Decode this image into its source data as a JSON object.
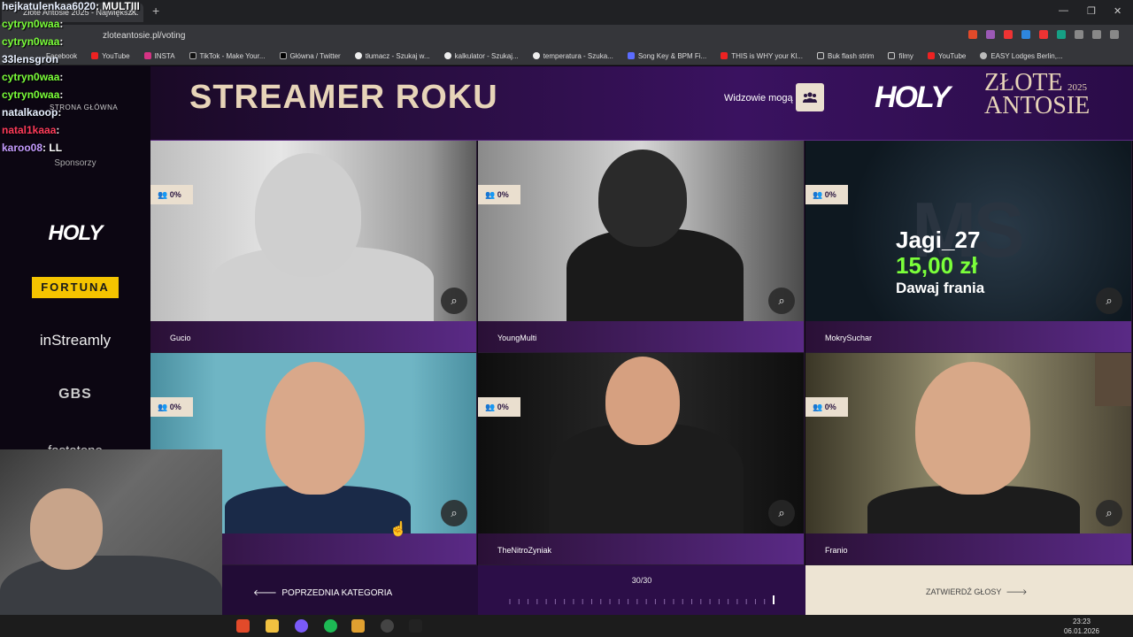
{
  "browser": {
    "tab_title": "Złote Antosie 2025 - Największ...",
    "tab_close": "✕",
    "new_tab": "+",
    "url": "zloteantosie.pl/voting",
    "bookmarks": [
      "Facebook",
      "YouTube",
      "INSTA",
      "TikTok - Make Your...",
      "Główna / Twitter",
      "tłumacz - Szukaj w...",
      "kalkulator - Szukaj...",
      "temperatura - Szuka...",
      "Song Key & BPM Fi...",
      "THIS is WHY your Kl...",
      "Buk flash strim",
      "filmy",
      "YouTube",
      "EASY Lodges Berlin,..."
    ],
    "window_controls": [
      "—",
      "❐",
      "✕"
    ]
  },
  "sidebar": {
    "nav_home": "STRONA GŁÓWNA",
    "sponsors_label": "Sponsorzy",
    "sponsors": [
      "HOLY",
      "FORTUNA",
      "inStreamly",
      "GBS",
      "fastatone"
    ]
  },
  "header": {
    "title": "STREAMER ROKU",
    "viewers_label": "Widzowie mogą",
    "brand_holy": "HOLY",
    "brand_zlote": "ZŁOTE",
    "brand_antosie": "ANTOSIE",
    "brand_year": "2025"
  },
  "nominees": [
    {
      "name": "Gucio",
      "votes": "0%"
    },
    {
      "name": "YoungMulti",
      "votes": "0%"
    },
    {
      "name": "MokrySuchar",
      "votes": "0%"
    },
    {
      "name": "",
      "votes": "0%"
    },
    {
      "name": "TheNitroZyniak",
      "votes": "0%"
    },
    {
      "name": "Franio",
      "votes": "0%"
    }
  ],
  "overlay_alert": {
    "bg_text": "MS",
    "user": "Jagi_27",
    "amount": "15,00 zł",
    "message": "Dawaj frania"
  },
  "footer": {
    "prev_label": "POPRZEDNIA KATEGORIA",
    "progress_label": "30/30",
    "progress_value": 1.0,
    "confirm_label": "ZATWIERDŹ GŁOSY"
  },
  "chat": [
    {
      "user": "hejkatulenkaa6020",
      "text": ": MULTIII",
      "color": "#e8f0ff"
    },
    {
      "user": "cytryn0waa",
      "text": ":",
      "color": "#7bff3a"
    },
    {
      "user": "cytryn0waa",
      "text": ":",
      "color": "#7bff3a"
    },
    {
      "user": "33lensgron",
      "text": "",
      "color": "#e8f0ff"
    },
    {
      "user": "cytryn0waa",
      "text": ":",
      "color": "#7bff3a"
    },
    {
      "user": "cytryn0waa",
      "text": ":",
      "color": "#7bff3a"
    },
    {
      "user": "natalkaoop",
      "text": ":",
      "color": "#e8f0ff"
    },
    {
      "user": "natal1kaaa",
      "text": ":",
      "color": "#ff3b5a"
    },
    {
      "user": "karoo08",
      "text": ": LL",
      "color": "#c49bff"
    }
  ],
  "taskbar": {
    "time": "23:23",
    "date": "06.01.2026"
  },
  "colors": {
    "accent_gold": "#e7d4b8",
    "purple_dark": "#220c36",
    "purple_mid": "#5a2a86",
    "alert_green": "#7bff3a"
  }
}
